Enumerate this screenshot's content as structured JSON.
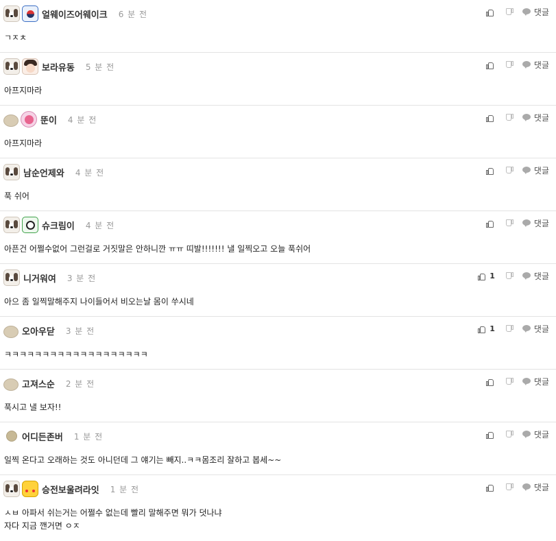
{
  "comments": [
    {
      "nick": "얼웨이즈어웨이크",
      "time": "6 분 전",
      "text": "ㄱㅈㅊ",
      "avatars": [
        "dog",
        "flag"
      ],
      "likes": ""
    },
    {
      "nick": "보라유동",
      "time": "5 분 전",
      "text": "아프지마라",
      "avatars": [
        "dog",
        "girl"
      ],
      "likes": ""
    },
    {
      "nick": "뚠이",
      "time": "4 분 전",
      "text": "아프지마라",
      "avatars": [
        "bean",
        "star"
      ],
      "likes": ""
    },
    {
      "nick": "남순언제와",
      "time": "4 분 전",
      "text": "푹 쉬어",
      "avatars": [
        "dog"
      ],
      "likes": ""
    },
    {
      "nick": "슈크림이",
      "time": "4 분 전",
      "text": "아픈건 어쩔수없어 그런걸로 거짓말은 안하니깐 ㅠㅠ 띠발!!!!!!! 낼 일찍오고 오늘 푹쉬어",
      "avatars": [
        "dog",
        "panda"
      ],
      "likes": ""
    },
    {
      "nick": "니거워여",
      "time": "3 분 전",
      "text": "아으 좀 일찍말해주지 나이들어서 비오는날 몸이 쑤시네",
      "avatars": [
        "dog"
      ],
      "likes": "1"
    },
    {
      "nick": "오아우닫",
      "time": "3 분 전",
      "text": "ㅋㅋㅋㅋㅋㅋㅋㅋㅋㅋㅋㅋㅋㅋㅋㅋㅋㅋㅋ",
      "avatars": [
        "bean"
      ],
      "likes": "1"
    },
    {
      "nick": "고져스순",
      "time": "2 분 전",
      "text": "푹시고 낼 보자!!",
      "avatars": [
        "bean"
      ],
      "likes": ""
    },
    {
      "nick": "어디든존버",
      "time": "1 분 전",
      "text": "일찍 온다고 오래하는 것도 아니던데 그 얘기는 빼지..ㅋㅋ몸조리 잘하고 봅세~~",
      "avatars": [
        "dot"
      ],
      "likes": ""
    },
    {
      "nick": "승전보울려라잇",
      "time": "1 분 전",
      "text": "ㅅㅂ 아파서 쉬는거는 어쩔수 없는데 빨리 말해주면 뭐가 덧나냐\n자다 지금 깬거면 ㅇㅈ",
      "avatars": [
        "dog",
        "pika"
      ],
      "likes": ""
    }
  ],
  "labels": {
    "reply": "댓글"
  },
  "icons": {
    "up": "thumbs-up-icon",
    "down": "thumbs-down-icon",
    "reply": "speech-bubble-icon"
  },
  "colors": {
    "divider": "#e3e3e3",
    "time": "#999999"
  }
}
